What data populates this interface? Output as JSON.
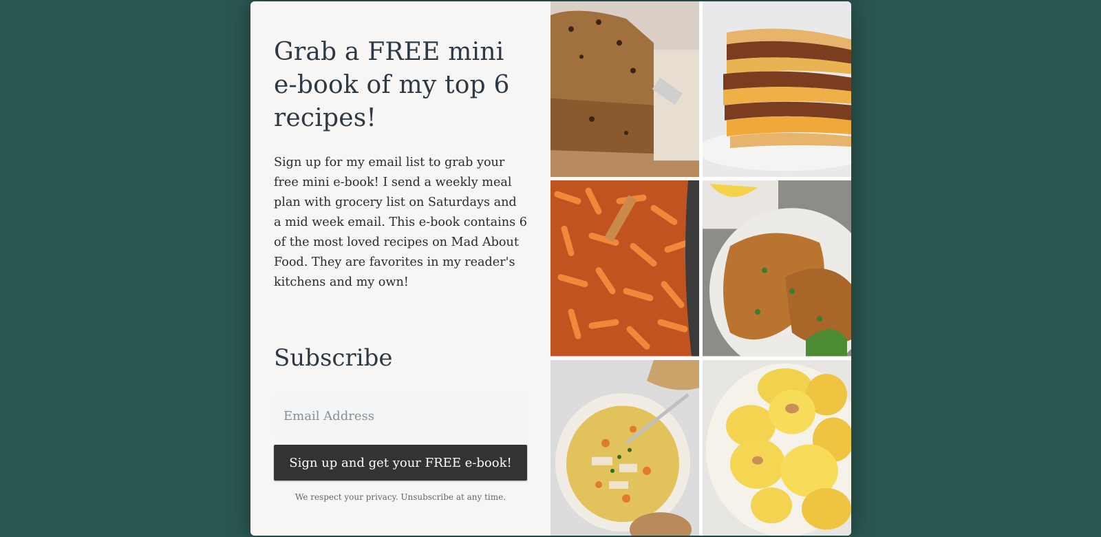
{
  "signup": {
    "headline": "Grab a FREE mini e-book of my top 6 recipes!",
    "description": "Sign up for my email list to grab your free mini e-book! I send a weekly meal plan with grocery list on Saturdays and a mid week email. This e-book contains 6 of the most loved recipes on Mad About Food. They are favorites in my reader's kitchens and my own!",
    "subscribe_heading": "Subscribe",
    "email_placeholder": "Email Address",
    "button_label": "Sign up and get your FREE e-book!",
    "privacy_note": "We respect your privacy. Unsubscribe at any time."
  },
  "theme": {
    "page_background": "#2a5651",
    "panel_background": "#f7f6f5",
    "button_background": "#333333",
    "button_text": "#ffffff",
    "heading_color": "#2d3a46"
  },
  "images": [
    "chocolate-chip-banana-bread-photo",
    "beef-quesadilla-stack-photo",
    "penne-pasta-pot-photo",
    "breaded-chicken-cutlet-photo",
    "chicken-vegetable-soup-photo",
    "egg-bites-plate-photo"
  ]
}
